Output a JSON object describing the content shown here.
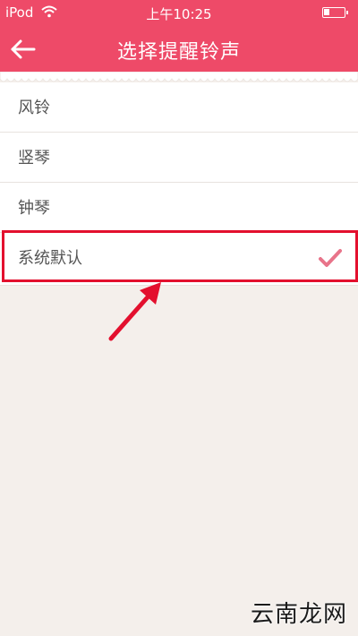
{
  "status_bar": {
    "carrier": "iPod",
    "time": "上午10:25",
    "battery_level": 0.3
  },
  "header": {
    "title": "选择提醒铃声",
    "back_icon": "arrow-left-icon"
  },
  "ringtones": [
    {
      "label": "风铃",
      "selected": false
    },
    {
      "label": "竖琴",
      "selected": false
    },
    {
      "label": "钟琴",
      "selected": false
    },
    {
      "label": "系统默认",
      "selected": true
    }
  ],
  "colors": {
    "accent": "#ee4a68",
    "highlight": "#e3102e",
    "check": "#e8748a",
    "background": "#f4efeb"
  },
  "watermark": "云南龙网"
}
